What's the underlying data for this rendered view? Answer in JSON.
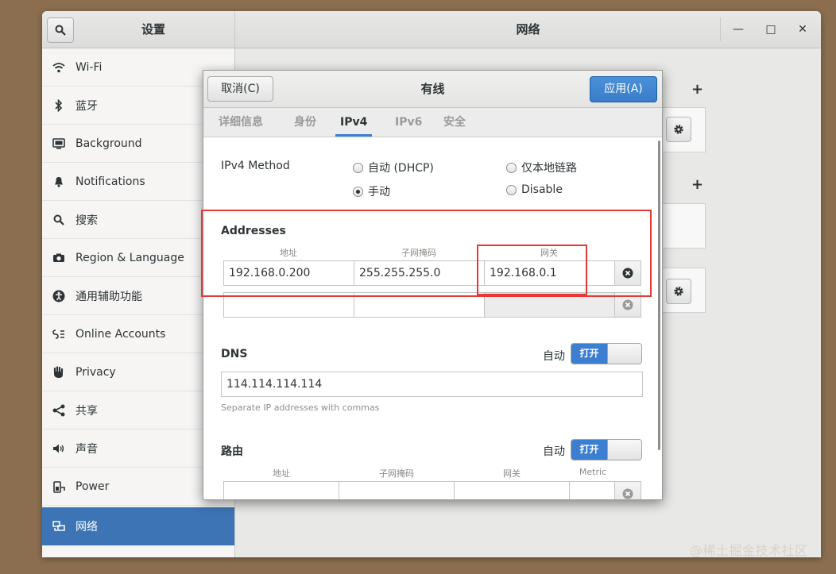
{
  "window": {
    "sidebar_title": "设置",
    "main_title": "网络",
    "minimize_glyph": "—",
    "maximize_glyph": "□",
    "close_glyph": "✕"
  },
  "sidebar": {
    "items": [
      {
        "label": "Wi-Fi",
        "icon": "wifi-icon"
      },
      {
        "label": "蓝牙",
        "icon": "bluetooth-icon"
      },
      {
        "label": "Background",
        "icon": "background-icon"
      },
      {
        "label": "Notifications",
        "icon": "bell-icon"
      },
      {
        "label": "搜索",
        "icon": "search-icon"
      },
      {
        "label": "Region & Language",
        "icon": "camera-icon"
      },
      {
        "label": "通用辅助功能",
        "icon": "accessibility-icon"
      },
      {
        "label": "Online Accounts",
        "icon": "online-accounts-icon"
      },
      {
        "label": "Privacy",
        "icon": "hand-icon"
      },
      {
        "label": "共享",
        "icon": "share-icon"
      },
      {
        "label": "声音",
        "icon": "speaker-icon"
      },
      {
        "label": "Power",
        "icon": "power-icon"
      },
      {
        "label": "网络",
        "icon": "network-icon",
        "active": true
      }
    ]
  },
  "main": {
    "add_glyph": "+"
  },
  "dialog": {
    "title": "有线",
    "cancel_label": "取消(C)",
    "apply_label": "应用(A)",
    "tabs": [
      {
        "label": "详细信息"
      },
      {
        "label": "身份"
      },
      {
        "label": "IPv4",
        "active": true
      },
      {
        "label": "IPv6"
      },
      {
        "label": "安全"
      }
    ],
    "ipv4": {
      "method_label": "IPv4 Method",
      "methods": [
        {
          "label": "自动 (DHCP)",
          "selected": false
        },
        {
          "label": "仅本地链路",
          "selected": false
        },
        {
          "label": "手动",
          "selected": true
        },
        {
          "label": "Disable",
          "selected": false
        }
      ],
      "addresses_label": "Addresses",
      "address_headers": [
        "地址",
        "子网掩码",
        "网关"
      ],
      "addresses": [
        {
          "address": "192.168.0.200",
          "netmask": "255.255.255.0",
          "gateway": "192.168.0.1"
        },
        {
          "address": "",
          "netmask": "",
          "gateway": ""
        }
      ],
      "dns_label": "DNS",
      "dns_auto_label": "自动",
      "dns_toggle_label": "打开",
      "dns_value": "114.114.114.114",
      "dns_hint": "Separate IP addresses with commas",
      "routes_label": "路由",
      "routes_auto_label": "自动",
      "routes_toggle_label": "打开",
      "route_headers": [
        "地址",
        "子网掩码",
        "网关",
        "Metric"
      ]
    }
  },
  "watermark": "@稀土掘金技术社区",
  "colors": {
    "accent": "#3c7fd0",
    "sidebar_active": "#3c74b5",
    "highlight_box": "#e53935"
  }
}
